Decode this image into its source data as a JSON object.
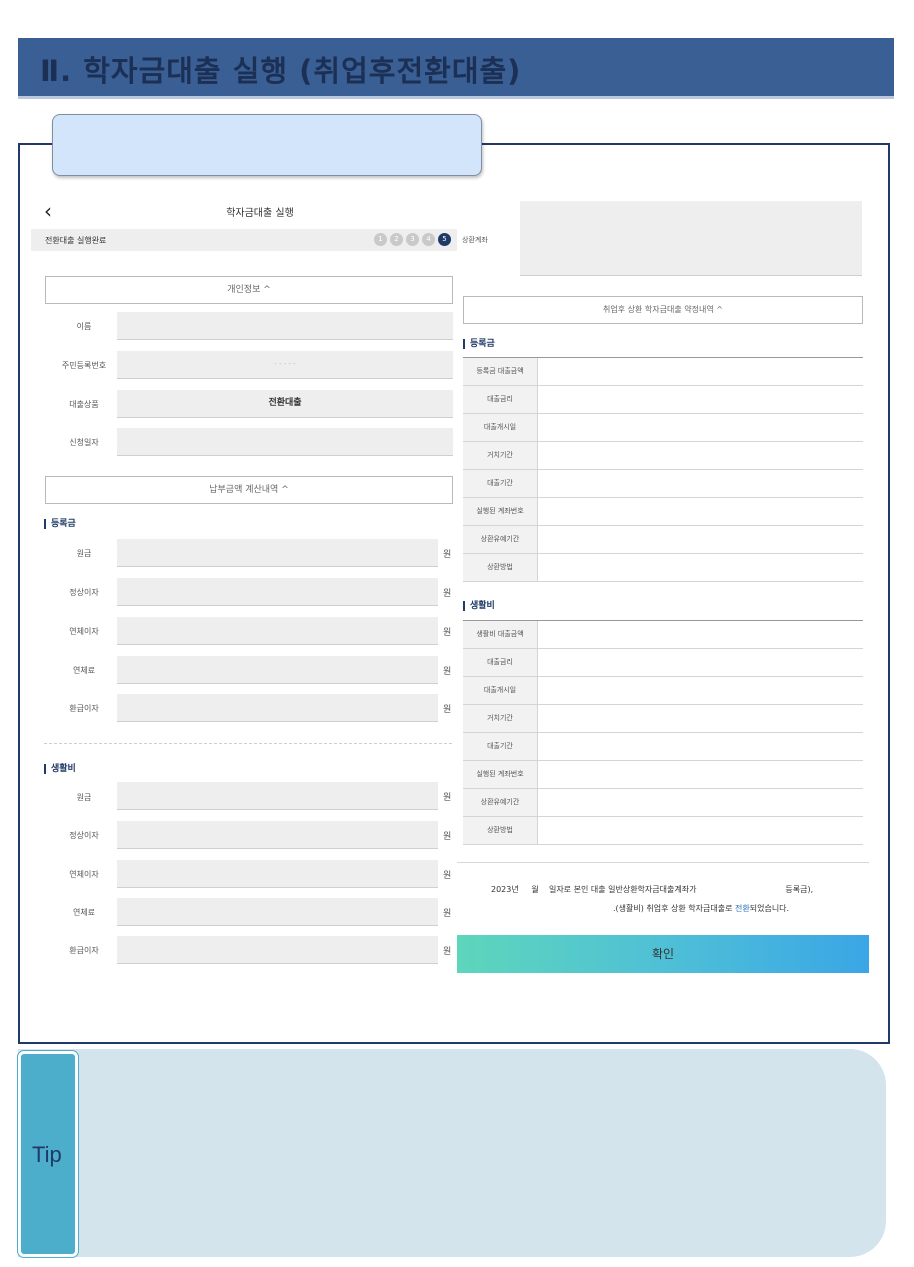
{
  "banner": {
    "title": "Ⅱ. 학자금대출 실행 (취업후전환대출)"
  },
  "screen": {
    "back_icon": "chevron-left-icon",
    "title": "학자금대출 실행",
    "step_label": "전환대출 실행완료",
    "steps": [
      "1",
      "2",
      "3",
      "4",
      "5"
    ],
    "active_step": 5
  },
  "personal": {
    "toggle_label": "개인정보 ^",
    "rows": [
      {
        "label": "이름",
        "value": ""
      },
      {
        "label": "주민등록번호",
        "value": "- - - - -"
      },
      {
        "label": "대출상품",
        "value": "전환대출"
      },
      {
        "label": "신청일자",
        "value": ""
      }
    ]
  },
  "calc": {
    "toggle_label": "납부금액 계산내역 ^",
    "tuition_heading": "등록금",
    "living_heading": "생활비",
    "unit": "원",
    "rows": [
      "원금",
      "정상이자",
      "연체이자",
      "연체료",
      "환급이자"
    ]
  },
  "repay": {
    "label": "상환계좌",
    "contract_toggle": "취업후 상환 학자금대출 약정내역 ^",
    "tuition_heading": "등록금",
    "tuition_rows": [
      "등록금 대출금액",
      "대출금리",
      "대출개시일",
      "거치기간",
      "대출기간",
      "실행된 계좌번호",
      "상환유예기간",
      "상환방법"
    ],
    "living_heading": "생활비",
    "living_rows": [
      "생활비 대출금액",
      "대출금리",
      "대출개시일",
      "거치기간",
      "대출기간",
      "실행된 계좌번호",
      "상환유예기간",
      "상환방법"
    ]
  },
  "notice": {
    "line1": "2023년     월    일자로 본인 대출 일반상환학자금대출계좌가                                   등록금),",
    "line2_prefix": ".(생활비) 취업후 상환 학자금대출로 ",
    "line2_link": "전환",
    "line2_suffix": "되었습니다."
  },
  "confirm_label": "확인",
  "tip_label": "Tip"
}
